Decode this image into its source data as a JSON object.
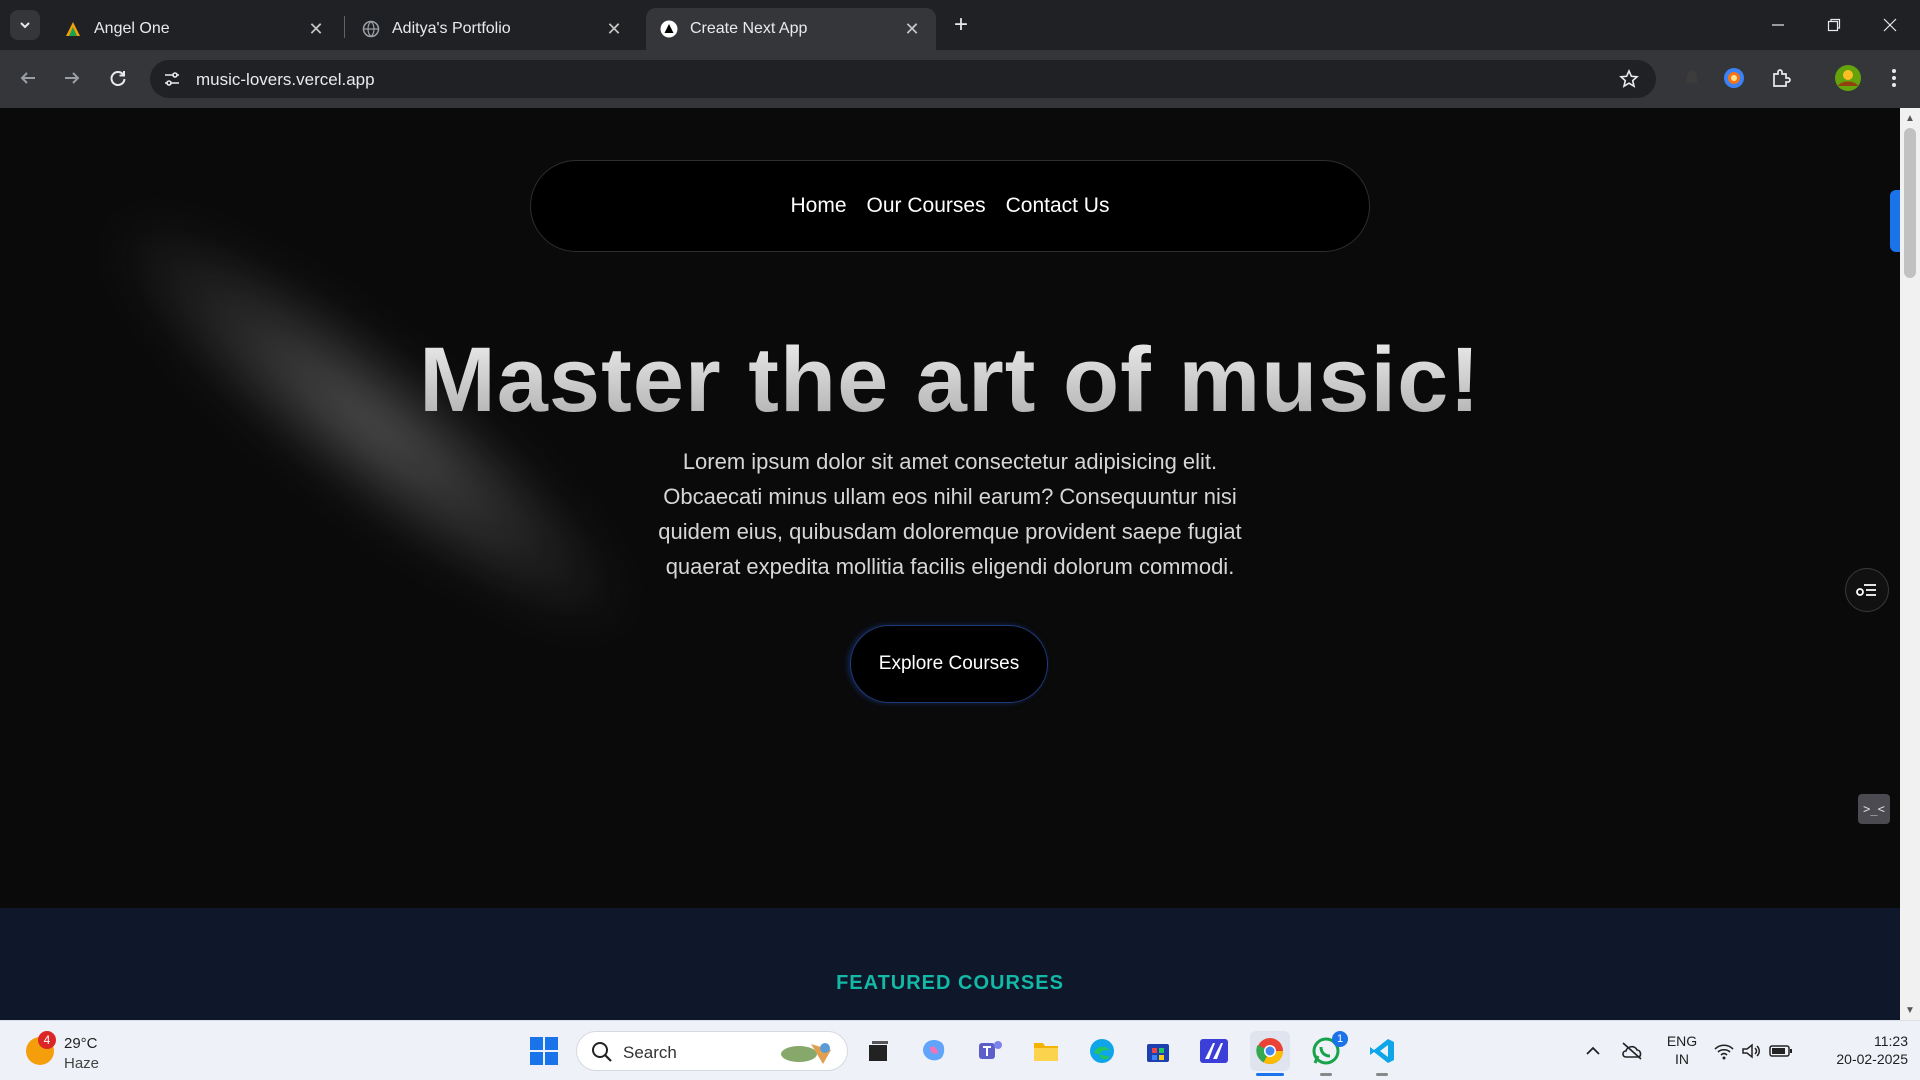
{
  "browser": {
    "tabs": [
      {
        "title": "Angel One",
        "active": false
      },
      {
        "title": "Aditya's Portfolio",
        "active": false
      },
      {
        "title": "Create Next App",
        "active": true
      }
    ],
    "url": "music-lovers.vercel.app"
  },
  "page": {
    "nav": {
      "home": "Home",
      "courses": "Our Courses",
      "contact": "Contact Us"
    },
    "hero_title": "Master the art of music!",
    "hero_text": "Lorem ipsum dolor sit amet consectetur adipisicing elit. Obcaecati minus ullam eos nihil earum? Consequuntur nisi quidem eius, quibusdam doloremque provident saepe fugiat quaerat expedita mollitia facilis eligendi dolorum commodi.",
    "cta": "Explore Courses",
    "featured": "FEATURED COURSES",
    "side_widget": ">_<"
  },
  "taskbar": {
    "weather": {
      "temp": "29°C",
      "cond": "Haze",
      "badge": "4"
    },
    "search_label": "Search",
    "whatsapp_badge": "1",
    "lang": {
      "line1": "ENG",
      "line2": "IN"
    },
    "clock": {
      "time": "11:23",
      "date": "20-02-2025"
    }
  },
  "colors": {
    "accent": "#1a73e8",
    "featured_teal": "#14b8a6",
    "featured_bg": "#0f172a"
  }
}
